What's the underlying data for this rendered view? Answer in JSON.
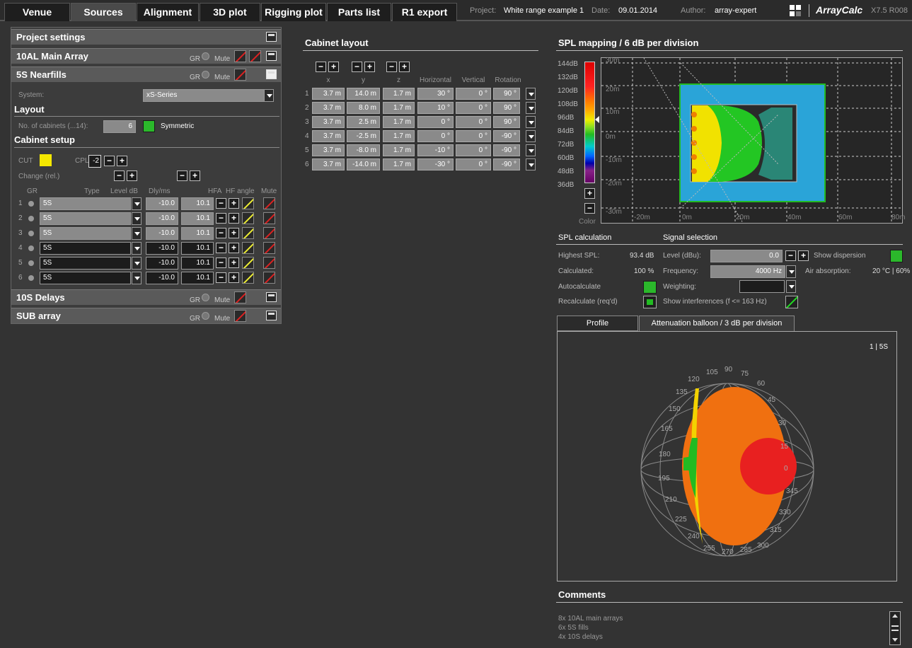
{
  "tabs": [
    "Venue",
    "Sources",
    "Alignment",
    "3D plot",
    "Rigging plot",
    "Parts list",
    "R1 export"
  ],
  "meta": {
    "project_label": "Project:",
    "project": "White range example 1",
    "date_label": "Date:",
    "date": "09.01.2014",
    "author_label": "Author:",
    "author": "array-expert",
    "brand": "ArrayCalc",
    "version": "X7.5 R008"
  },
  "left": {
    "project_settings": "Project settings",
    "groups": [
      {
        "name": "10AL Main Array"
      },
      {
        "name": "5S Nearfills"
      },
      {
        "name": "10S Delays"
      },
      {
        "name": "SUB array"
      }
    ],
    "gr_label": "GR",
    "mute_label": "Mute",
    "system_label": "System:",
    "system_value": "xS-Series",
    "layout_label": "Layout",
    "cabinets_label": "No. of cabinets (...14):",
    "cabinets_value": "6",
    "symmetric_label": "Symmetric",
    "cabinet_setup": "Cabinet setup",
    "cut_label": "CUT",
    "cpl_label": "CPL",
    "cpl_value": "-2",
    "change_label": "Change (rel.)",
    "cols": {
      "gr": "GR",
      "type": "Type",
      "level": "Level dB",
      "dly": "Dly/ms",
      "hfa": "HFA",
      "hfangle": "HF angle",
      "mute": "Mute"
    },
    "rows": [
      {
        "n": "1",
        "type": "5S",
        "dly": "-10.0",
        "hfa": "10.1"
      },
      {
        "n": "2",
        "type": "5S",
        "dly": "-10.0",
        "hfa": "10.1"
      },
      {
        "n": "3",
        "type": "5S",
        "dly": "-10.0",
        "hfa": "10.1"
      },
      {
        "n": "4",
        "type": "5S",
        "dly": "-10.0",
        "hfa": "10.1"
      },
      {
        "n": "5",
        "type": "5S",
        "dly": "-10.0",
        "hfa": "10.1"
      },
      {
        "n": "6",
        "type": "5S",
        "dly": "-10.0",
        "hfa": "10.1"
      }
    ]
  },
  "cabinet": {
    "title": "Cabinet layout",
    "headers": [
      "x",
      "y",
      "z",
      "Horizontal",
      "Vertical",
      "Rotation"
    ],
    "rows": [
      {
        "n": "1",
        "x": "3.7 m",
        "y": "14.0 m",
        "z": "1.7 m",
        "h": "30 °",
        "v": "0 °",
        "r": "90 °"
      },
      {
        "n": "2",
        "x": "3.7 m",
        "y": "8.0 m",
        "z": "1.7 m",
        "h": "10 °",
        "v": "0 °",
        "r": "90 °"
      },
      {
        "n": "3",
        "x": "3.7 m",
        "y": "2.5 m",
        "z": "1.7 m",
        "h": "0 °",
        "v": "0 °",
        "r": "90 °"
      },
      {
        "n": "4",
        "x": "3.7 m",
        "y": "-2.5 m",
        "z": "1.7 m",
        "h": "0 °",
        "v": "0 °",
        "r": "-90 °"
      },
      {
        "n": "5",
        "x": "3.7 m",
        "y": "-8.0 m",
        "z": "1.7 m",
        "h": "-10 °",
        "v": "0 °",
        "r": "-90 °"
      },
      {
        "n": "6",
        "x": "3.7 m",
        "y": "-14.0 m",
        "z": "1.7 m",
        "h": "-30 °",
        "v": "0 °",
        "r": "-90 °"
      }
    ]
  },
  "spl": {
    "title": "SPL mapping / 6 dB per division",
    "scale": [
      "144dB",
      "132dB",
      "120dB",
      "108dB",
      "96dB",
      "84dB",
      "72dB",
      "60dB",
      "48dB",
      "36dB"
    ],
    "color_label": "Color",
    "ylabels": [
      "30m",
      "20m",
      "10m",
      "0m",
      "-10m",
      "-20m",
      "-30m"
    ],
    "xlabels": [
      "-20m",
      "0m",
      "20m",
      "40m",
      "60m",
      "80m"
    ]
  },
  "calc": {
    "spl_calc": "SPL calculation",
    "signal_sel": "Signal selection",
    "highest_label": "Highest SPL:",
    "highest_value": "93.4 dB",
    "calculated_label": "Calculated:",
    "calculated_value": "100 %",
    "autocalc_label": "Autocalculate",
    "recalc_label": "Recalculate (req'd)",
    "level_label": "Level (dBu):",
    "level_value": "0.0",
    "freq_label": "Frequency:",
    "freq_value": "4000 Hz",
    "weighting_label": "Weighting:",
    "interf_label": "Show interferences (f <= 163 Hz)",
    "dispersion_label": "Show dispersion",
    "air_label": "Air absorption:",
    "air_value": "20 °C | 60%"
  },
  "balloon": {
    "tab_profile": "Profile",
    "tab_balloon": "Attenuation balloon / 3 dB per division",
    "corner": "1 | 5S",
    "angles": [
      "105",
      "90",
      "75",
      "120",
      "60",
      "135",
      "45",
      "150",
      "30",
      "165",
      "15",
      "180",
      "0",
      "195",
      "345",
      "210",
      "330",
      "225",
      "315",
      "240",
      "300",
      "255",
      "270",
      "285"
    ]
  },
  "comments": {
    "title": "Comments",
    "lines": [
      "8x 10AL main arrays",
      "6x 5S fills",
      "4x 10S delays"
    ]
  },
  "colors": {
    "accent_green": "#2bb82b",
    "cut_yellow": "#f5e800",
    "mute_red": "#d22"
  }
}
